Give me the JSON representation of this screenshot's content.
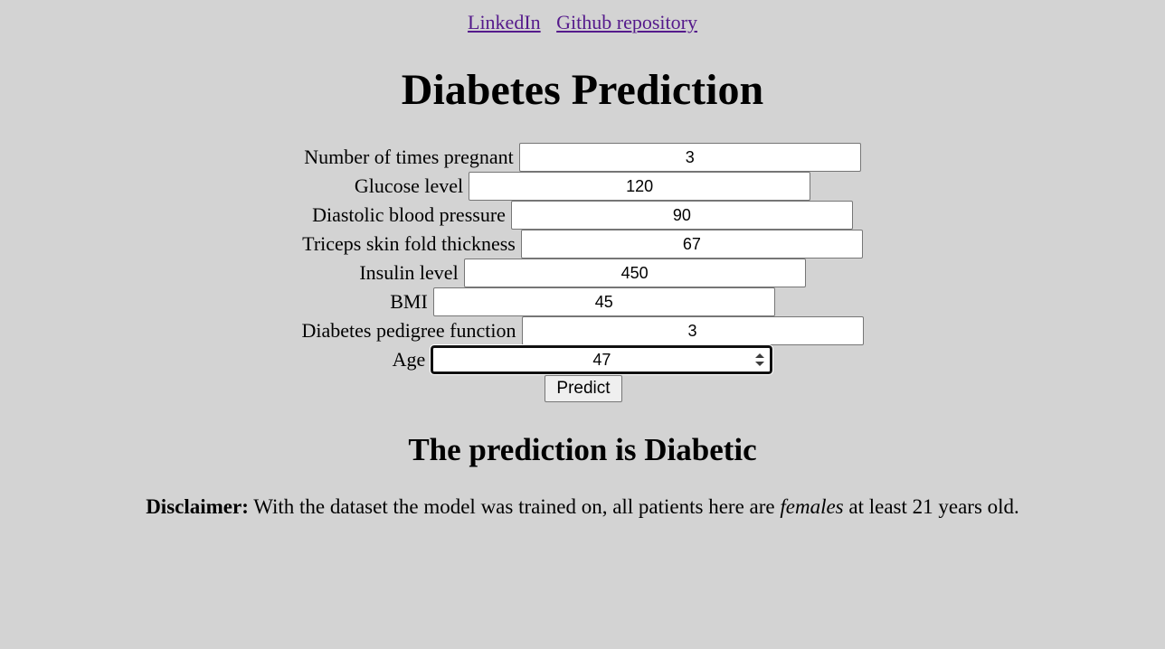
{
  "links": {
    "linkedin": "LinkedIn",
    "github": "Github repository"
  },
  "title": "Diabetes Prediction",
  "form": {
    "fields": [
      {
        "label": "Number of times pregnant",
        "value": "3"
      },
      {
        "label": "Glucose level",
        "value": "120"
      },
      {
        "label": "Diastolic blood pressure",
        "value": "90"
      },
      {
        "label": "Triceps skin fold thickness",
        "value": "67"
      },
      {
        "label": "Insulin level",
        "value": "450"
      },
      {
        "label": "BMI",
        "value": "45"
      },
      {
        "label": "Diabetes pedigree function",
        "value": "3"
      },
      {
        "label": "Age",
        "value": "47"
      }
    ],
    "submit_label": "Predict"
  },
  "result": "The prediction is Diabetic",
  "disclaimer": {
    "label": "Disclaimer:",
    "text_before": " With the dataset the model was trained on, all patients here are ",
    "emphasis": "females",
    "text_after": " at least 21 years old."
  }
}
